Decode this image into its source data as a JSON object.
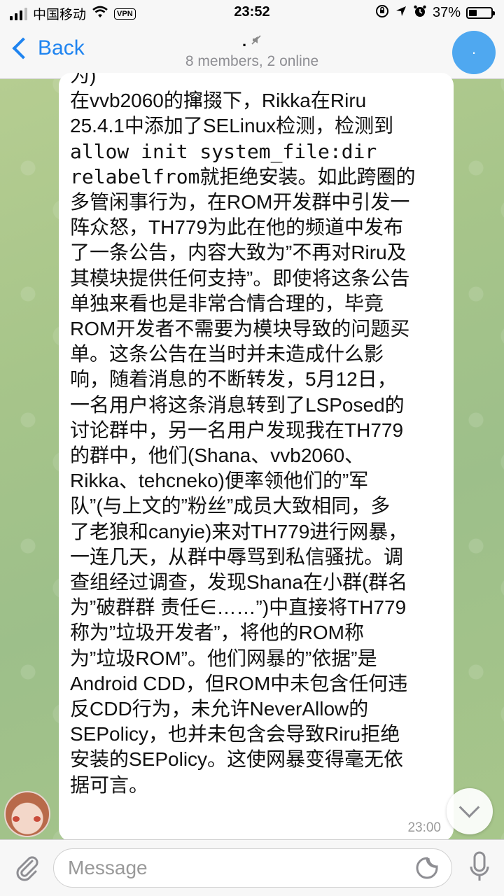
{
  "status_bar": {
    "carrier": "中国移动",
    "vpn": "VPN",
    "time": "23:52",
    "battery_percent": "37%",
    "battery_level": 0.37
  },
  "header": {
    "back_label": "Back",
    "title": ".",
    "subtitle": "8 members, 2 online",
    "avatar_text": "·"
  },
  "message": {
    "time": "23:00",
    "lines": [
      "为)",
      "在vvb2060的撺掇下，Rikka在Riru",
      "25.4.1中添加了SELinux检测，检测到",
      "allow init system_file:dir",
      "relabelfrom就拒绝安装。如此跨圈的",
      "多管闲事行为，在ROM开发群中引发一",
      "阵众怒，TH779为此在他的频道中发布",
      "了一条公告，内容大致为”不再对Riru及",
      "其模块提供任何支持”。即使将这条公告",
      "单独来看也是非常合情合理的，毕竟",
      "ROM开发者不需要为模块导致的问题买",
      "单。这条公告在当时并未造成什么影",
      "响，随着消息的不断转发，5月12日，",
      "一名用户将这条消息转到了LSPosed的",
      "讨论群中，另一名用户发现我在TH779",
      "的群中，他们(Shana、vvb2060、",
      "Rikka、tehcneko)便率领他们的”军",
      "队”(与上文的”粉丝”成员大致相同，多",
      "了老狼和canyie)来对TH779进行网暴，",
      "一连几天，从群中辱骂到私信骚扰。调",
      "查组经过调查，发现Shana在小群(群名",
      "为”破群群 责任∈……”)中直接将TH779",
      "称为”垃圾开发者”，将他的ROM称",
      "为”垃圾ROM”。他们网暴的”依据”是",
      "Android CDD，但ROM中未包含任何违",
      "反CDD行为，未允许NeverAllow的",
      "SEPolicy，也并未包含会导致Riru拒绝",
      "安装的SEPolicy。这使网暴变得毫无依",
      "据可言。"
    ]
  },
  "input": {
    "placeholder": "Message"
  }
}
